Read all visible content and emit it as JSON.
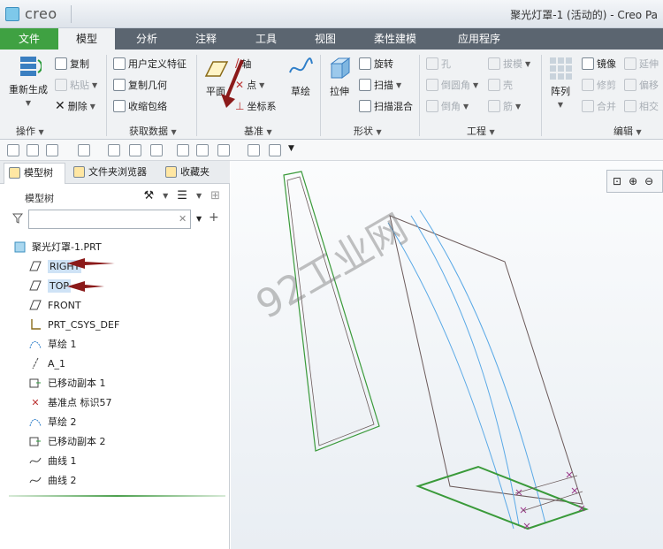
{
  "titlebar": {
    "logo_text": "creo",
    "window_title": "聚光灯罩-1 (活动的) - Creo Pa"
  },
  "tabs": [
    "文件",
    "模型",
    "分析",
    "注释",
    "工具",
    "视图",
    "柔性建模",
    "应用程序"
  ],
  "active_tab": "模型",
  "ribbon": {
    "operations": {
      "regenerate": "重新生成",
      "copy": "复制",
      "paste": "粘贴",
      "delete": "删除",
      "group_label": "操作"
    },
    "get_data": {
      "udf": "用户定义特征",
      "copy_geom": "复制几何",
      "shrinkwrap": "收缩包络",
      "group_label": "获取数据"
    },
    "datum": {
      "plane": "平面",
      "axis": "轴",
      "point": "点",
      "csys": "坐标系",
      "sketch": "草绘",
      "group_label": "基准"
    },
    "shapes": {
      "extrude": "拉伸",
      "revolve": "旋转",
      "sweep": "扫描",
      "swept_blend": "扫描混合",
      "group_label": "形状"
    },
    "engineering": {
      "hole": "孔",
      "draft": "拔模",
      "round": "倒圆角",
      "shell": "壳",
      "chamfer": "倒角",
      "rib": "筋",
      "group_label": "工程"
    },
    "editing": {
      "pattern": "阵列",
      "mirror": "镜像",
      "extend": "延伸",
      "trim": "修剪",
      "offset": "偏移",
      "merge": "合并",
      "intersect": "相交",
      "group_label": "编辑"
    }
  },
  "panel": {
    "tabs": [
      "模型树",
      "文件夹浏览器",
      "收藏夹"
    ],
    "header": "模型树",
    "filter_placeholder": "",
    "tree": [
      {
        "label": "聚光灯罩-1.PRT",
        "icon": "part-icon"
      },
      {
        "label": "RIGHT",
        "icon": "datum-plane-icon",
        "selected": true
      },
      {
        "label": "TOP",
        "icon": "datum-plane-icon",
        "selected": true
      },
      {
        "label": "FRONT",
        "icon": "datum-plane-icon"
      },
      {
        "label": "PRT_CSYS_DEF",
        "icon": "csys-icon"
      },
      {
        "label": "草绘 1",
        "icon": "sketch-icon"
      },
      {
        "label": "A_1",
        "icon": "axis-icon"
      },
      {
        "label": "已移动副本 1",
        "icon": "moved-copy-icon"
      },
      {
        "label": "基准点 标识57",
        "icon": "datum-point-icon"
      },
      {
        "label": "草绘 2",
        "icon": "sketch-icon"
      },
      {
        "label": "已移动副本 2",
        "icon": "moved-copy-icon"
      },
      {
        "label": "曲线 1",
        "icon": "curve-icon"
      },
      {
        "label": "曲线 2",
        "icon": "curve-icon"
      }
    ]
  },
  "watermark": "92工业网",
  "colors": {
    "file_tab": "#3fa142",
    "tab_bar": "#5b6570",
    "selection": "#cfe3f6",
    "annotation_arrow": "#8b1a1a",
    "curve_blue": "#5aa9e6",
    "edge_green": "#3a9a3a"
  }
}
